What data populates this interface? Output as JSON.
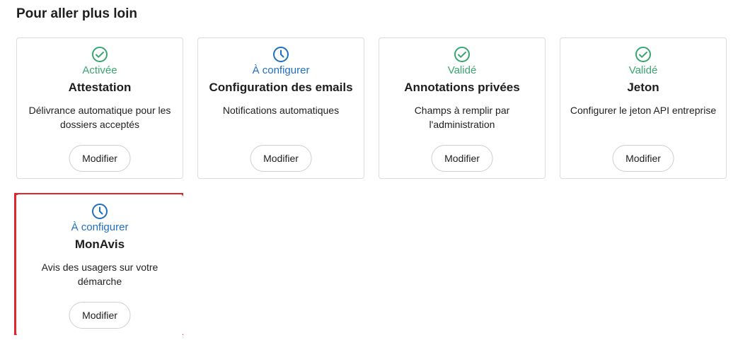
{
  "section_title": "Pour aller plus loin",
  "colors": {
    "success": "#3aa56f",
    "pending": "#1f6fbf",
    "highlight": "#e0262b"
  },
  "cards": [
    {
      "status": "Activée",
      "status_icon": "check-circle-icon",
      "title": "Attestation",
      "description": "Délivrance automatique pour les dossiers acceptés",
      "button": "Modifier"
    },
    {
      "status": "À configurer",
      "status_icon": "clock-icon",
      "title": "Configuration des emails",
      "description": "Notifications automatiques",
      "button": "Modifier"
    },
    {
      "status": "Validé",
      "status_icon": "check-circle-icon",
      "title": "Annotations privées",
      "description": "Champs à remplir par l'administration",
      "button": "Modifier"
    },
    {
      "status": "Validé",
      "status_icon": "check-circle-icon",
      "title": "Jeton",
      "description": "Configurer le jeton API entreprise",
      "button": "Modifier"
    },
    {
      "status": "À configurer",
      "status_icon": "clock-icon",
      "title": "MonAvis",
      "description": "Avis des usagers sur votre démarche",
      "button": "Modifier"
    }
  ]
}
